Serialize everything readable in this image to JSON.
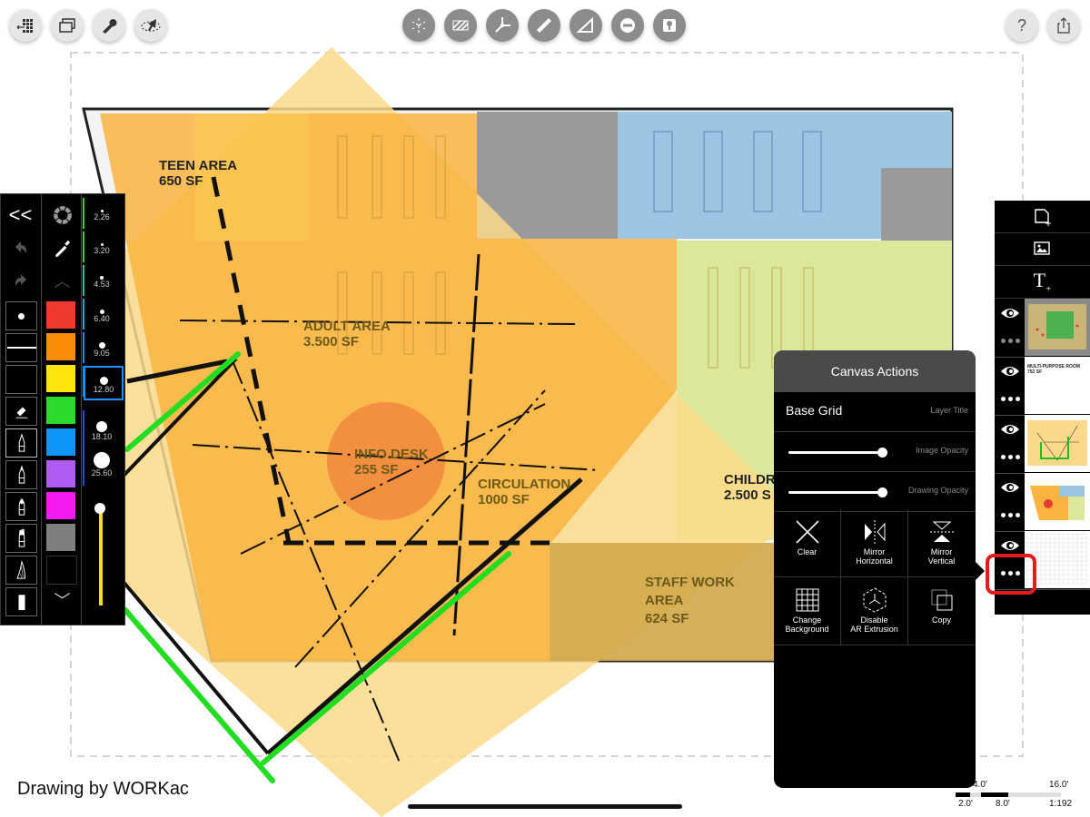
{
  "top_toolbar": {
    "left_buttons": [
      {
        "name": "grid-exit-icon",
        "label": "Exit grid"
      },
      {
        "name": "layers-stack-icon",
        "label": "Windows"
      },
      {
        "name": "wrench-icon",
        "label": "Tools"
      },
      {
        "name": "ar-pointer-icon",
        "label": "AR"
      }
    ],
    "center_buttons": [
      {
        "name": "3d-cube-icon",
        "label": "3D"
      },
      {
        "name": "hatch-icon",
        "label": "Hatch"
      },
      {
        "name": "axis-icon",
        "label": "Axis"
      },
      {
        "name": "ruler-icon",
        "label": "Ruler"
      },
      {
        "name": "set-square-icon",
        "label": "Set square"
      },
      {
        "name": "minus-circle-icon",
        "label": "Subtract"
      },
      {
        "name": "image-tree-icon",
        "label": "Image"
      }
    ],
    "right_buttons": [
      {
        "name": "help-icon",
        "label": "?"
      },
      {
        "name": "share-icon",
        "label": "Share"
      }
    ]
  },
  "floor_plan": {
    "rooms": [
      {
        "id": "teen",
        "line1": "TEEN AREA",
        "line2": "650 SF"
      },
      {
        "id": "adult",
        "line1": "ADULT AREA",
        "line2": "3.500 SF"
      },
      {
        "id": "info",
        "line1": "INFO DESK",
        "line2": "255 SF"
      },
      {
        "id": "circulation",
        "line1": "CIRCULATION",
        "line2": "1000 SF"
      },
      {
        "id": "children",
        "line1": "CHILDR",
        "line2": "2.500 S"
      },
      {
        "id": "staff",
        "line1": "STAFF WORK",
        "line2": "AREA",
        "line3": "624 SF"
      }
    ],
    "colors": {
      "orange_zone": "#f9b43f",
      "light_yellow_zone": "#fbd98a",
      "info_circle": "#f0883e",
      "grey_rooms": "#9a9a9a",
      "blue_room": "#9cc5e3",
      "green_zone": "#dde79a",
      "green_stroke": "#22dd22",
      "staff_room": "#d2a84a"
    }
  },
  "palette": {
    "tools": [
      {
        "name": "collapse-icon",
        "glyph": "<<"
      },
      {
        "name": "undo-icon"
      },
      {
        "name": "redo-icon"
      },
      {
        "name": "point-tool-icon"
      },
      {
        "name": "line-tool-icon"
      },
      {
        "name": "fill-tool-icon"
      },
      {
        "name": "eraser-icon"
      },
      {
        "name": "pen-fine-icon"
      },
      {
        "name": "pen-medium-icon"
      },
      {
        "name": "pen-round-icon"
      },
      {
        "name": "marker-icon"
      },
      {
        "name": "brush-icon"
      },
      {
        "name": "chisel-icon"
      }
    ],
    "colors": [
      "#ef3a2f",
      "#fb8c0a",
      "#fde40a",
      "#2bdb2b",
      "#0d95f7",
      "#b05cf2",
      "#f41af0",
      "#7f7f7f",
      "#000000"
    ],
    "sizes": [
      "2.26",
      "3.20",
      "4.53",
      "6.40",
      "9.05",
      "12.80",
      "18.10",
      "25.60"
    ],
    "selected_size": "12.80",
    "opacity_slider_color": "#f5e000",
    "opacity_value": 1.0
  },
  "canvas_actions": {
    "title": "Canvas Actions",
    "layer_name": "Base Grid",
    "layer_title_label": "Layer Title",
    "image_opacity_label": "Image Opacity",
    "image_opacity": 1.0,
    "drawing_opacity_label": "Drawing Opacity",
    "drawing_opacity": 1.0,
    "actions": [
      {
        "name": "clear",
        "label": "Clear"
      },
      {
        "name": "mirror-horizontal",
        "label": "Mirror\nHorizontal"
      },
      {
        "name": "mirror-vertical",
        "label": "Mirror\nVertical"
      },
      {
        "name": "change-background",
        "label": "Change\nBackground"
      },
      {
        "name": "disable-ar-extrusion",
        "label": "Disable\nAR Extrusion"
      },
      {
        "name": "copy",
        "label": "Copy"
      }
    ]
  },
  "layers_panel": {
    "add_buttons": [
      {
        "name": "new-page-icon"
      },
      {
        "name": "add-image-icon"
      },
      {
        "name": "add-text-icon"
      }
    ],
    "layers": [
      {
        "thumb": "site-plan",
        "visible": true
      },
      {
        "thumb": "text",
        "text": "MULTI-PURPOSE ROOM\n752 SF",
        "visible": true
      },
      {
        "thumb": "sketch",
        "visible": true
      },
      {
        "thumb": "floor-plan",
        "visible": true
      },
      {
        "thumb": "grid",
        "visible": true,
        "selected": true
      }
    ]
  },
  "scale_bar": {
    "labels_top": [
      "4.0'",
      "16.0'"
    ],
    "labels_bottom": [
      "2.0'",
      "8.0'"
    ],
    "ratio": "1:192"
  },
  "credit": "Drawing by WORKac"
}
